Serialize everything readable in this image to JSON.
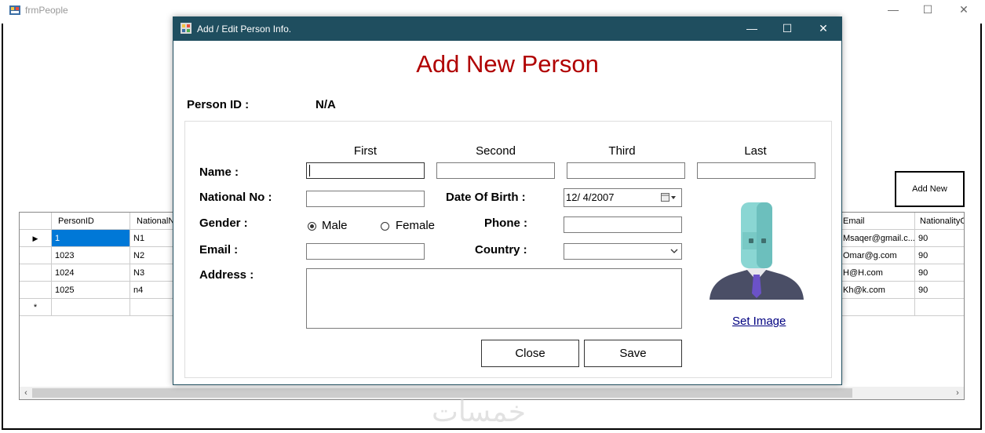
{
  "parent_window": {
    "title": "frmPeople",
    "controls": {
      "minimize": "—",
      "maximize": "☐",
      "close": "✕"
    },
    "add_new_label": "Add New"
  },
  "grid": {
    "left_columns": [
      "PersonID",
      "NationalN"
    ],
    "right_columns": [
      "Email",
      "NationalityC"
    ],
    "rows": [
      {
        "person_id": "1",
        "national_no": "N1",
        "email": "Msaqer@gmail.c...",
        "nationality": "90",
        "selected": true
      },
      {
        "person_id": "1023",
        "national_no": "N2",
        "email": "Omar@g.com",
        "nationality": "90",
        "selected": false
      },
      {
        "person_id": "1024",
        "national_no": "N3",
        "email": "H@H.com",
        "nationality": "90",
        "selected": false
      },
      {
        "person_id": "1025",
        "national_no": "n4",
        "email": "Kh@k.com",
        "nationality": "90",
        "selected": false
      }
    ],
    "current_row_marker": "▶",
    "new_row_marker": "*",
    "scroll_left": "‹",
    "scroll_right": "›"
  },
  "dialog": {
    "title": "Add / Edit Person Info.",
    "controls": {
      "minimize": "—",
      "maximize": "☐",
      "close": "✕"
    },
    "heading": "Add New Person",
    "person_id_label": "Person ID  :",
    "person_id_value": "N/A",
    "name_columns": [
      "First",
      "Second",
      "Third",
      "Last"
    ],
    "labels": {
      "name": "Name :",
      "national_no": "National No :",
      "gender": "Gender :",
      "email": "Email :",
      "address": "Address :",
      "date_of_birth": "Date Of Birth :",
      "phone": "Phone :",
      "country": "Country :"
    },
    "fields": {
      "first": "",
      "second": "",
      "third": "",
      "last": "",
      "national_no": "",
      "email": "",
      "phone": "",
      "address": "",
      "date_of_birth": "12/  4/2007",
      "country": ""
    },
    "gender_options": [
      "Male",
      "Female"
    ],
    "gender_selected": "Male",
    "set_image_label": "Set Image",
    "close_label": "Close",
    "save_label": "Save"
  },
  "colors": {
    "dialog_titlebar": "#1f4e5f",
    "heading": "#b00000",
    "selection": "#0078d7",
    "link": "#000080"
  },
  "watermark": "خمسات"
}
